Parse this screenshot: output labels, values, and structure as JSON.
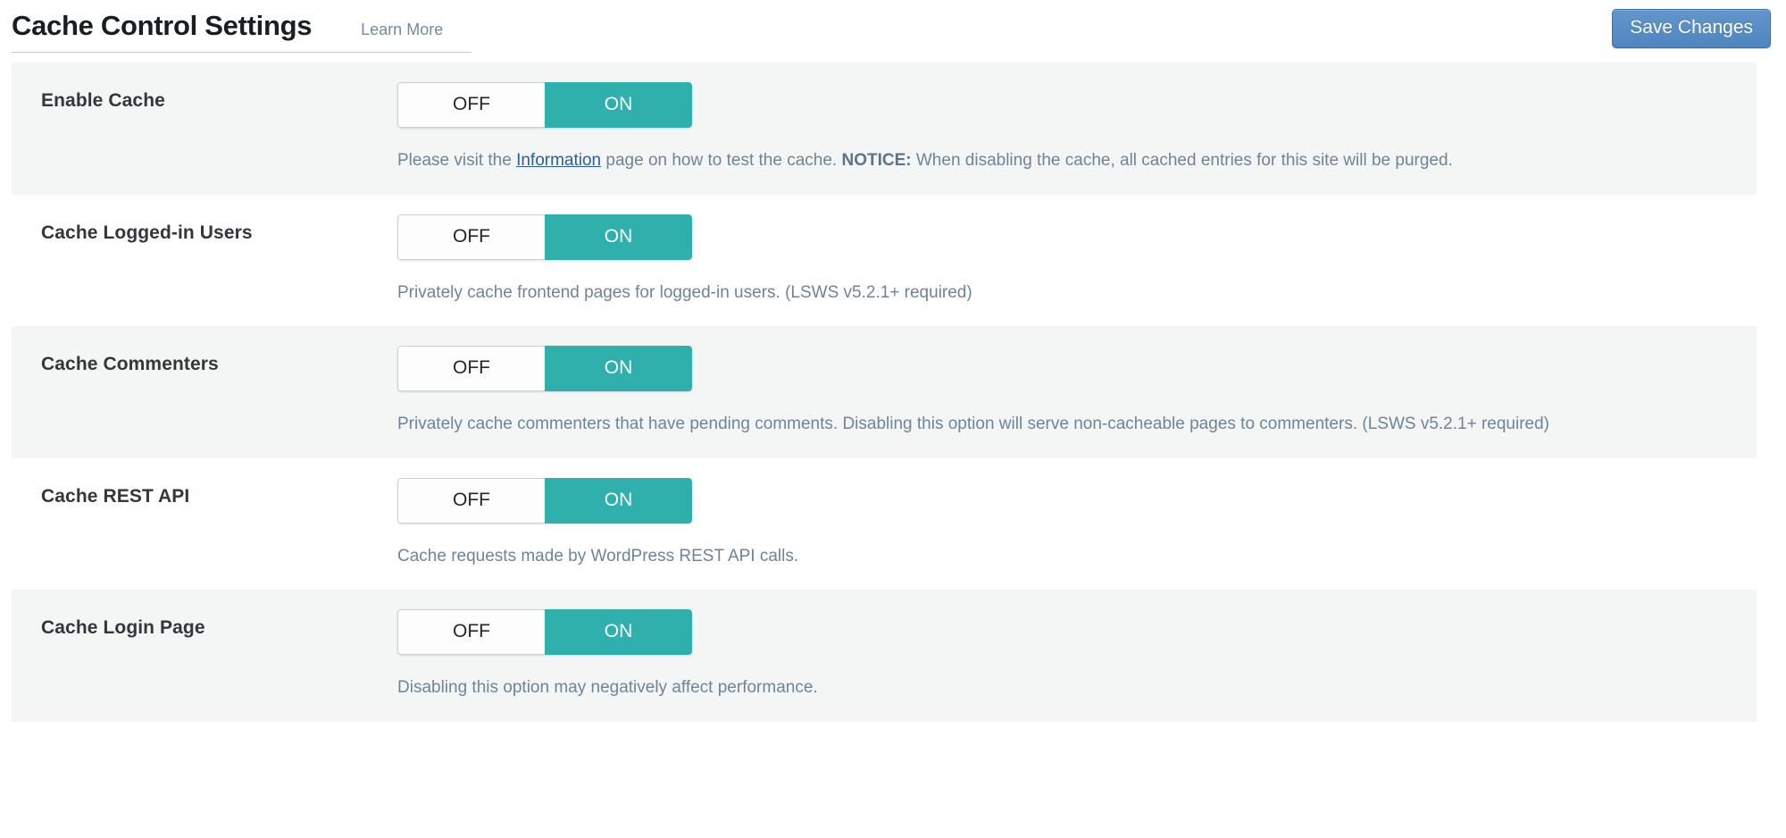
{
  "header": {
    "title": "Cache Control Settings",
    "learn_more_label": "Learn More",
    "save_label": "Save Changes",
    "accent_teal": "#2fb0ad",
    "button_blue": "#5d8fc4",
    "link_blue": "#2a5d9e",
    "desc_color": "#6f8496",
    "alt_row_bg": "#f4f6f6"
  },
  "toggle_labels": {
    "off": "OFF",
    "on": "ON"
  },
  "rows": [
    {
      "label": "Enable Cache",
      "state": "ON",
      "desc_prefix": "Please visit the ",
      "desc_link": "Information",
      "desc_middle": " page on how to test the cache. ",
      "desc_notice": "NOTICE:",
      "desc_suffix": " When disabling the cache, all cached entries for this site will be purged."
    },
    {
      "label": "Cache Logged-in Users",
      "state": "ON",
      "desc": "Privately cache frontend pages for logged-in users. (LSWS v5.2.1+ required)"
    },
    {
      "label": "Cache Commenters",
      "state": "ON",
      "desc": "Privately cache commenters that have pending comments. Disabling this option will serve non-cacheable pages to commenters. (LSWS v5.2.1+ required)"
    },
    {
      "label": "Cache REST API",
      "state": "ON",
      "desc": "Cache requests made by WordPress REST API calls."
    },
    {
      "label": "Cache Login Page",
      "state": "ON",
      "desc": "Disabling this option may negatively affect performance."
    }
  ]
}
